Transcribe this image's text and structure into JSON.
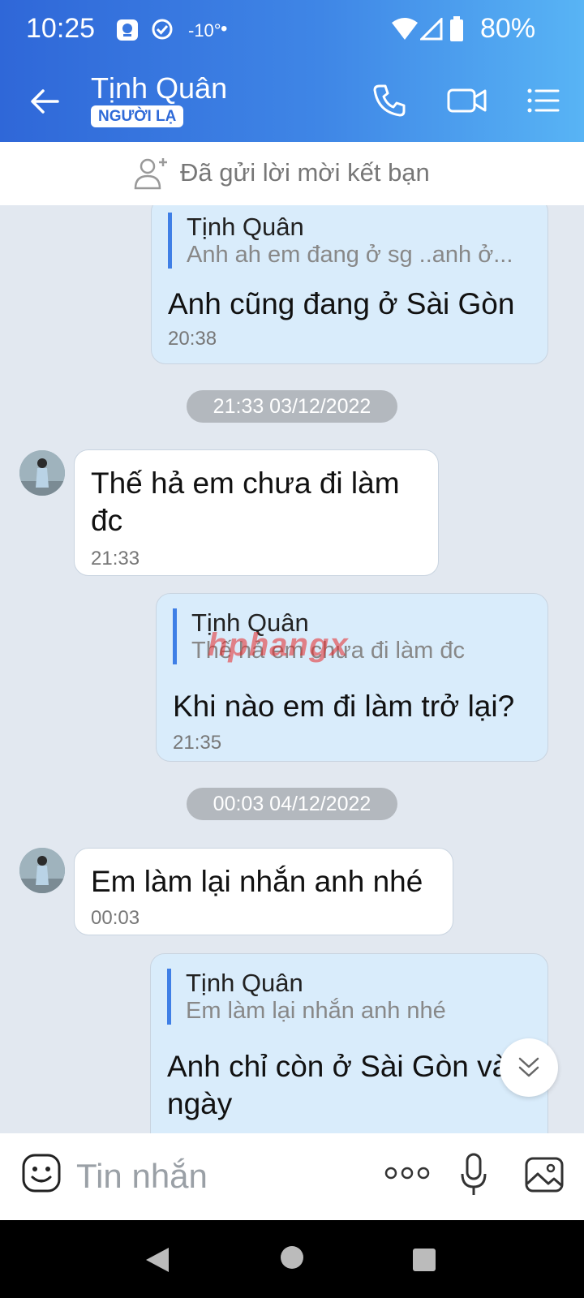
{
  "status_bar": {
    "time": "10:25",
    "temperature": "-10°",
    "dot": "•",
    "battery": "80%"
  },
  "header": {
    "title": "Tịnh Quân",
    "badge": "NGƯỜI LẠ"
  },
  "friend_bar": {
    "text": "Đã gửi lời mời kết bạn"
  },
  "messages": [
    {
      "direction": "out",
      "quote_name": "Tịnh Quân",
      "quote_text": "Anh ah em đang ở sg ..anh ở...",
      "text": "Anh cũng đang ở Sài Gòn",
      "time": "20:38"
    },
    {
      "type": "date",
      "text": "21:33 03/12/2022"
    },
    {
      "direction": "in",
      "text": "Thế hả em chưa đi làm đc",
      "line1": "Thế hả em chưa đi làm",
      "line2": "đc",
      "time": "21:33"
    },
    {
      "direction": "out",
      "quote_name": "Tịnh Quân",
      "quote_text": "Thế hả em chưa đi làm đc",
      "text": "Khi nào em đi làm trở lại?",
      "time": "21:35"
    },
    {
      "type": "date",
      "text": "00:03 04/12/2022"
    },
    {
      "direction": "in",
      "text": "Em làm lại nhắn anh nhé",
      "time": "00:03"
    },
    {
      "direction": "out",
      "quote_name": "Tịnh Quân",
      "quote_text": "Em làm lại nhắn anh nhé",
      "line1": "Anh chỉ còn ở Sài Gòn vài",
      "line2": "ngày"
    }
  ],
  "watermark": "hphangx",
  "composer": {
    "placeholder": "Tin nhắn"
  },
  "icons": {
    "back": "arrow-left-icon",
    "call": "phone-icon",
    "video": "video-camera-icon",
    "menu": "list-icon",
    "add_friend": "user-plus-icon",
    "emoji": "emoji-icon",
    "more": "more-dots-icon",
    "mic": "microphone-icon",
    "image": "image-icon",
    "scroll_down": "double-chevron-down-icon"
  },
  "colors": {
    "header_start": "#2f67d8",
    "header_end": "#58b4f5",
    "out_bubble": "#d9ecfb",
    "chat_bg": "#e2e8f0"
  }
}
